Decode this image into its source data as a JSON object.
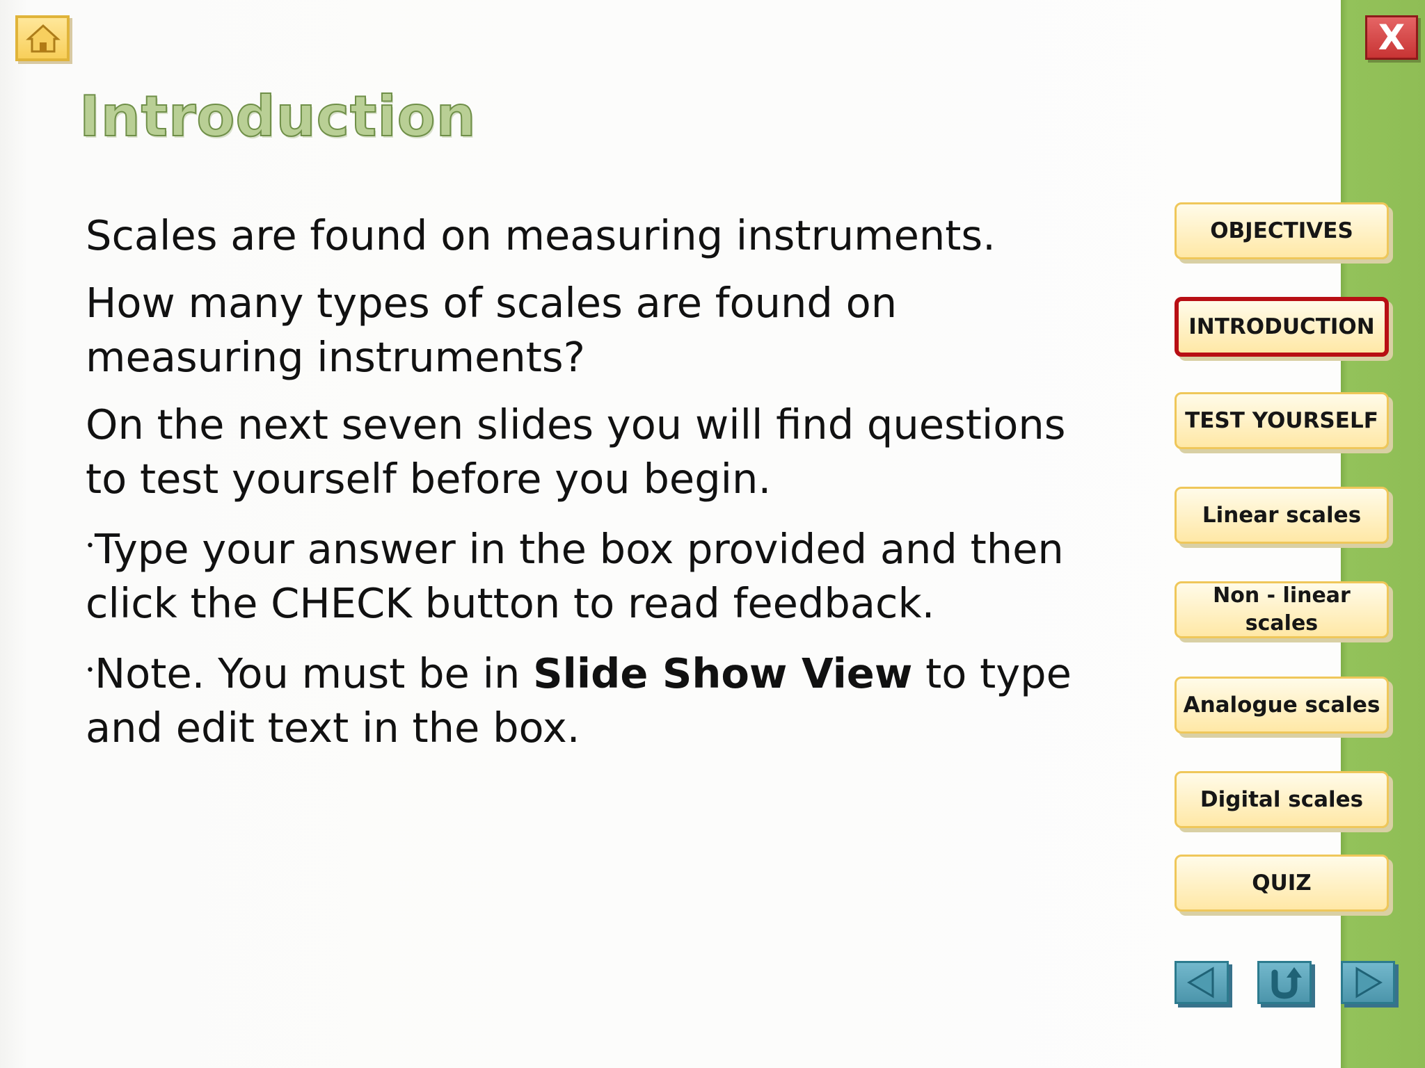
{
  "title": "Introduction",
  "paragraphs": [
    {
      "text": "Scales are found on measuring instruments."
    },
    {
      "text": "How many types of scales are found on measuring instruments?"
    },
    {
      "text": "On the next seven slides you will find questions to test yourself before you begin."
    },
    {
      "bullet": "•",
      "text": "Type your answer in the box provided and then click the CHECK button to read feedback."
    },
    {
      "bullet": "•",
      "before": "Note. You must be in ",
      "bold": "Slide Show View",
      "after": " to type and edit text in the box."
    }
  ],
  "menu": [
    {
      "label": "OBJECTIVES",
      "active": false
    },
    {
      "label": "INTRODUCTION",
      "active": true
    },
    {
      "label": "TEST YOURSELF",
      "active": false
    },
    {
      "label": "Linear scales",
      "active": false
    },
    {
      "label": "Non - linear scales",
      "line1": "Non - linear",
      "line2": "scales",
      "active": false
    },
    {
      "label": "Analogue scales",
      "active": false
    },
    {
      "label": "Digital scales",
      "active": false
    },
    {
      "label": "QUIZ",
      "active": false
    }
  ],
  "controls": {
    "close_label": "X",
    "home_icon": "house-icon",
    "previous_icon": "triangle-left-icon",
    "return_icon": "return-arrow-icon",
    "next_icon": "triangle-right-icon"
  },
  "colors": {
    "sidebar_green": "#8fbd55",
    "menu_border": "#efc75a",
    "menu_active_border": "#b80f14",
    "title_fill": "#b9cf95",
    "title_outline": "#6f8f48",
    "nav_blue": "#5ea8be",
    "close_red": "#c83434"
  }
}
